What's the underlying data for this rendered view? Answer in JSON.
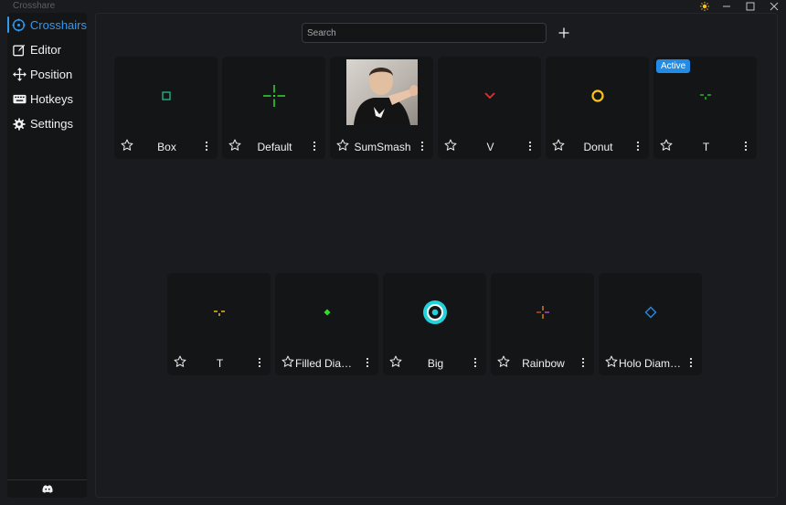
{
  "app": {
    "title": "Crosshare"
  },
  "window_controls": [
    {
      "name": "theme-toggle",
      "icon": "sun-icon"
    },
    {
      "name": "minimize",
      "icon": "minimize-icon"
    },
    {
      "name": "maximize",
      "icon": "maximize-icon"
    },
    {
      "name": "close",
      "icon": "close-icon"
    }
  ],
  "sidebar": {
    "items": [
      {
        "label": "Crosshairs",
        "icon": "crosshair-icon",
        "active": true
      },
      {
        "label": "Editor",
        "icon": "edit-icon"
      },
      {
        "label": "Position",
        "icon": "move-icon"
      },
      {
        "label": "Hotkeys",
        "icon": "keyboard-icon"
      },
      {
        "label": "Settings",
        "icon": "gear-icon"
      }
    ],
    "footer_icon": "discord-icon"
  },
  "toolbar": {
    "search_placeholder": "Search",
    "add_icon": "plus-icon"
  },
  "badge": {
    "active_label": "Active"
  },
  "colors": {
    "accent": "#339af0",
    "badge": "#228be6",
    "card_bg": "#141517",
    "page_bg": "#1a1b1e"
  },
  "crosshairs": [
    {
      "name": "Box",
      "preview": "small-box",
      "color": "#20c997"
    },
    {
      "name": "Default",
      "preview": "cross-gap",
      "color": "#2fdd2f"
    },
    {
      "name": "SumSmash",
      "preview": "photo-thumbnail"
    },
    {
      "name": "V",
      "preview": "v-chevron",
      "color": "#e03131"
    },
    {
      "name": "Donut",
      "preview": "ring",
      "color": "#fcc419"
    },
    {
      "name": "T",
      "preview": "t-shape",
      "color": "#2fdd2f",
      "active": true
    },
    {
      "name": "T",
      "preview": "t-shape",
      "color": "#fcc419"
    },
    {
      "name": "Filled Diamond",
      "preview": "filled-diamond",
      "color": "#2fdd2f"
    },
    {
      "name": "Big",
      "preview": "big-circle",
      "color": "#22d3dc"
    },
    {
      "name": "Rainbow",
      "preview": "rainbow-cross",
      "color": "#ff922b"
    },
    {
      "name": "Holo Diamond",
      "preview": "hollow-diamond",
      "color": "#228be6"
    }
  ]
}
